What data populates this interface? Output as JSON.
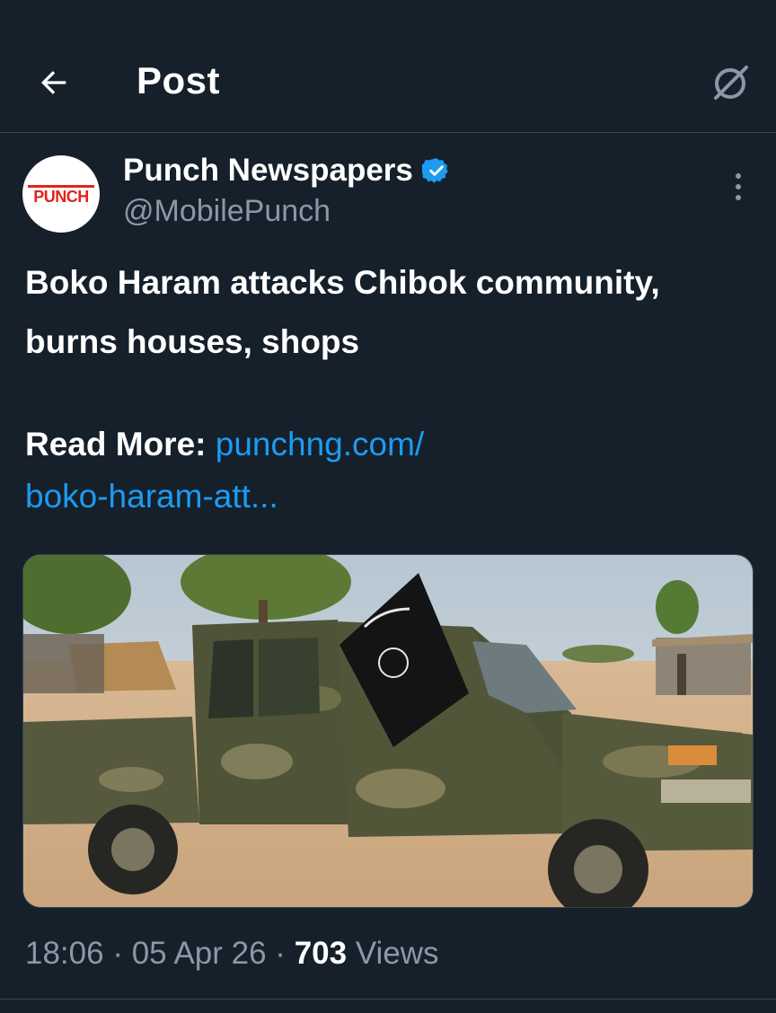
{
  "header": {
    "title": "Post"
  },
  "author": {
    "name": "Punch Newspapers",
    "handle": "@MobilePunch",
    "avatar_text": "PUNCH",
    "verified": true
  },
  "post": {
    "text": "Boko Haram attacks Chibok community, burns houses, shops",
    "read_more_label": "Read More:",
    "link_line1": "punchng.com/",
    "link_line2": "boko-haram-att..."
  },
  "meta": {
    "time": "18:06",
    "date": "05 Apr 26",
    "views_count": "703",
    "views_label": "Views"
  },
  "icons": {
    "back": "arrow-left-icon",
    "grok": "grok-icon",
    "more": "more-vertical-icon",
    "verified": "verified-badge-icon"
  },
  "colors": {
    "background": "#15202b",
    "accent": "#1d9bf0",
    "secondary_text": "#8b98a5",
    "divider": "#38444d",
    "brand_red": "#e2231a"
  }
}
